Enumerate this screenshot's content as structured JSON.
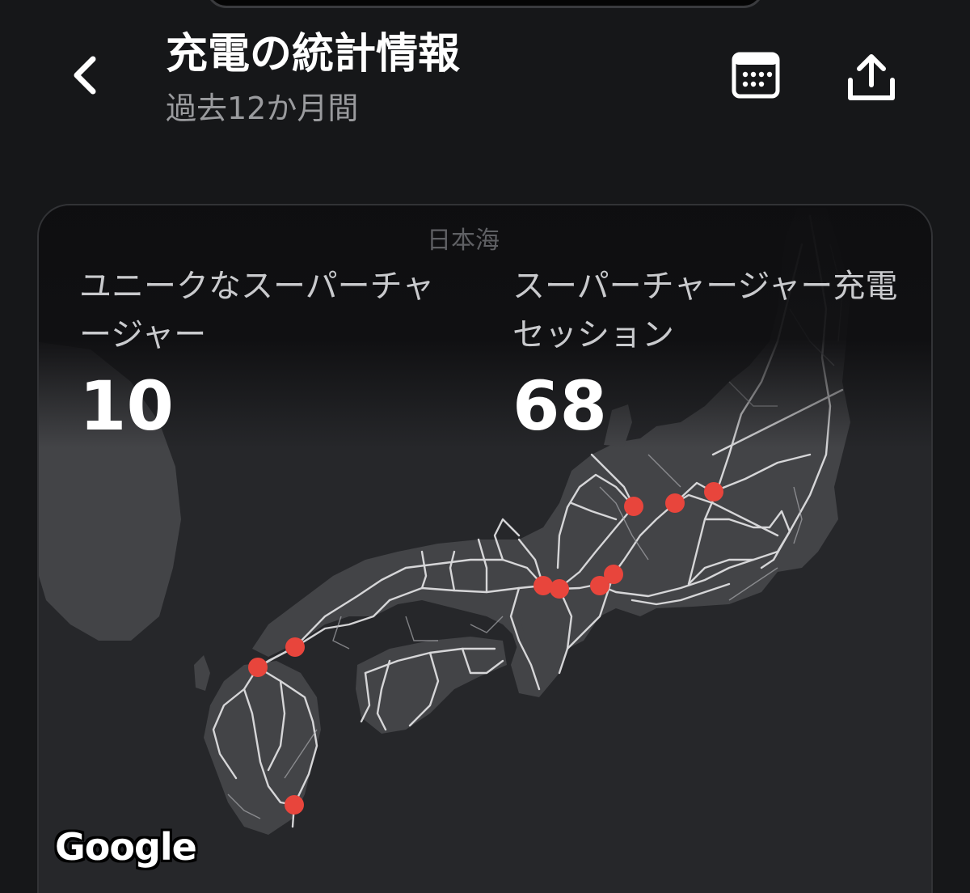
{
  "header": {
    "title": "充電の統計情報",
    "subtitle": "過去12か月間",
    "back_icon": "chevron-left-icon",
    "calendar_icon": "calendar-icon",
    "share_icon": "share-icon"
  },
  "map": {
    "sea_label": "日本海",
    "provider_logo": "Google",
    "marker_color": "#e8453c",
    "road_color": "#e6e6e8",
    "land_color": "#434447",
    "water_color": "#26272a"
  },
  "stats": {
    "unique_label": "ユニークなスーパーチャージャー",
    "unique_value": "10",
    "sessions_label": "スーパーチャージャー充電セッション",
    "sessions_value": "68"
  }
}
